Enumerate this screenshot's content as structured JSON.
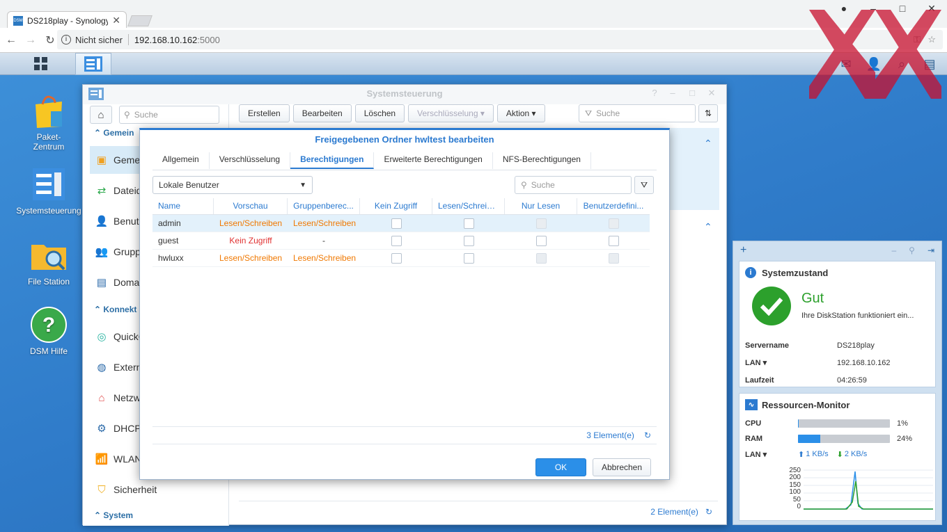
{
  "browser": {
    "tab_title": "DS218play - Synology Di",
    "tab_close": "✕",
    "insecure_label": "Nicht sicher",
    "url_host": "192.168.10.162",
    "url_port": ":5000",
    "favicon_text": "DSM"
  },
  "desktop_icons": [
    {
      "label": "Paket-\nZentrum"
    },
    {
      "label": "Systemsteuerung"
    },
    {
      "label": "File Station"
    },
    {
      "label": "DSM Hilfe"
    }
  ],
  "window": {
    "title": "Systemsteuerung",
    "side_search_placeholder": "Suche",
    "sidebar": {
      "section_general": "Gemein",
      "items_general": [
        "Gemei",
        "Dateid",
        "Benutz",
        "Grupp",
        "Domai"
      ],
      "section_connectivity": "Konnekt",
      "items_connectivity": [
        "QuickC",
        "Extern",
        "Netzw",
        "DHCP-",
        "WLAN",
        "Sicherheit"
      ],
      "section_system": "System"
    },
    "toolbar": {
      "create": "Erstellen",
      "edit": "Bearbeiten",
      "delete": "Löschen",
      "encryption": "Verschlüsselung ▾",
      "action": "Aktion ▾"
    },
    "search_placeholder": "Suche",
    "footer_count": "2 Element(e)"
  },
  "dialog": {
    "title": "Freigegebenen Ordner hwltest bearbeiten",
    "tabs": [
      "Allgemein",
      "Verschlüsselung",
      "Berechtigungen",
      "Erweiterte Berechtigungen",
      "NFS-Berechtigungen"
    ],
    "user_select": "Lokale Benutzer",
    "search_placeholder": "Suche",
    "columns": [
      "Name",
      "Vorschau",
      "Gruppenberec...",
      "Kein Zugriff",
      "Lesen/Schreiben",
      "Nur Lesen",
      "Benutzerdefini..."
    ],
    "rows": [
      {
        "name": "admin",
        "preview": "Lesen/Schreiben",
        "group": "Lesen/Schreiben"
      },
      {
        "name": "guest",
        "preview": "Kein Zugriff",
        "group": "-"
      },
      {
        "name": "hwluxx",
        "preview": "Lesen/Schreiben",
        "group": "Lesen/Schreiben"
      }
    ],
    "count": "3 Element(e)",
    "ok": "OK",
    "cancel": "Abbrechen"
  },
  "widgets": {
    "health": {
      "title": "Systemzustand",
      "status": "Gut",
      "message": "Ihre DiskStation funktioniert ein...",
      "fields": [
        {
          "k": "Servername",
          "v": "DS218play"
        },
        {
          "k": "LAN ▾",
          "v": "192.168.10.162"
        },
        {
          "k": "Laufzeit",
          "v": "04:26:59"
        }
      ]
    },
    "monitor": {
      "title": "Ressourcen-Monitor",
      "cpu_label": "CPU",
      "cpu_value": "1%",
      "cpu_pct": 1,
      "ram_label": "RAM",
      "ram_value": "24%",
      "ram_pct": 24,
      "lan_label": "LAN ▾",
      "lan_up": "1 KB/s",
      "lan_down": "2 KB/s",
      "y_ticks": [
        "250",
        "200",
        "150",
        "100",
        "50",
        "0"
      ]
    }
  },
  "colors": {
    "accent": "#2b7ad0",
    "orange": "#f07800",
    "red": "#e03030",
    "good": "#2ca02c"
  }
}
